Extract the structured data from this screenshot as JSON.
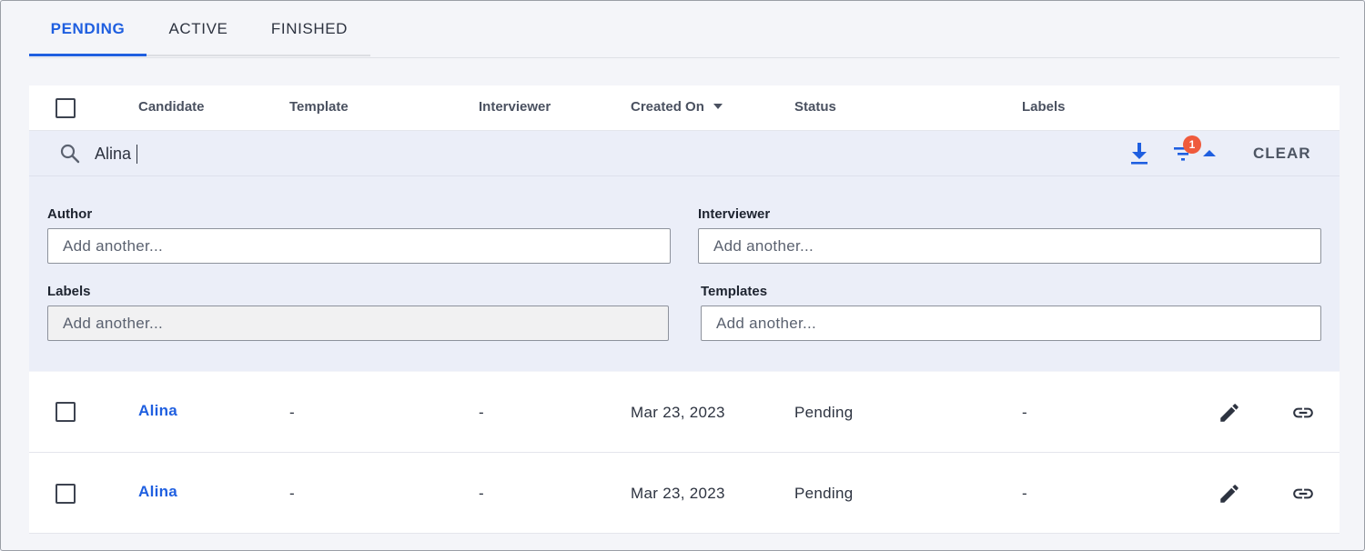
{
  "tabs": [
    {
      "label": "PENDING",
      "active": true
    },
    {
      "label": "ACTIVE",
      "active": false
    },
    {
      "label": "FINISHED",
      "active": false
    }
  ],
  "table": {
    "columns": [
      "Candidate",
      "Template",
      "Interviewer",
      "Created On",
      "Status",
      "Labels"
    ],
    "sort_column": "Created On",
    "sort_direction": "descending"
  },
  "search": {
    "value": "Alina",
    "download_icon": "download-icon",
    "filter_icon": "filter-icon",
    "active_filter_count": "1",
    "clear_label": "CLEAR"
  },
  "filters": {
    "author": {
      "label": "Author",
      "placeholder": "Add another..."
    },
    "interviewer": {
      "label": "Interviewer",
      "placeholder": "Add another..."
    },
    "labels": {
      "label": "Labels",
      "placeholder": "Add another..."
    },
    "templates": {
      "label": "Templates",
      "placeholder": "Add another..."
    }
  },
  "rows": [
    {
      "candidate": "Alina",
      "template": "-",
      "interviewer": "-",
      "created_on": "Mar 23, 2023",
      "status": "Pending",
      "labels": "-"
    },
    {
      "candidate": "Alina",
      "template": "-",
      "interviewer": "-",
      "created_on": "Mar 23, 2023",
      "status": "Pending",
      "labels": "-"
    }
  ],
  "colors": {
    "accent": "#1f5fe0",
    "badge": "#ef5a3c",
    "filter_panel": "#ebeef8"
  }
}
